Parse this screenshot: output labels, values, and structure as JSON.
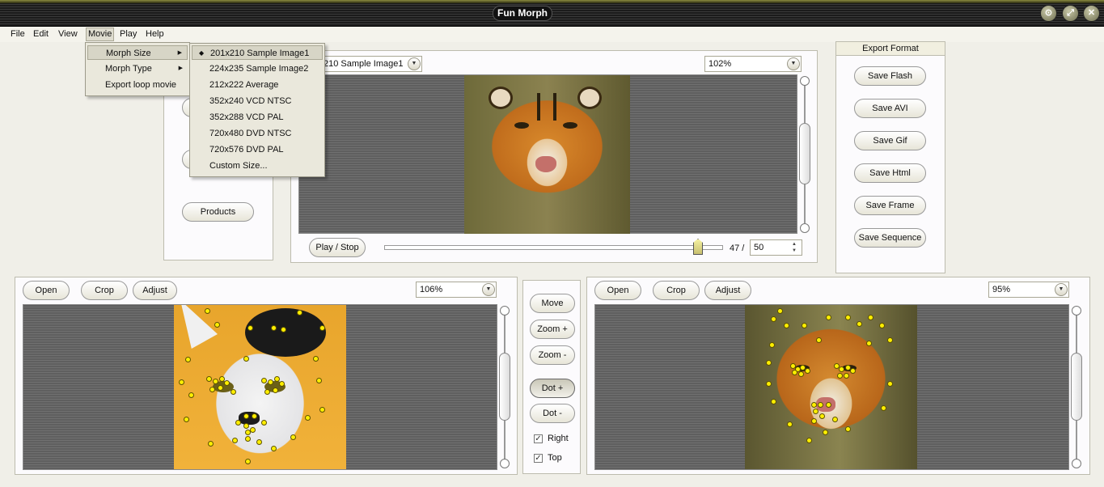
{
  "window": {
    "title": "Fun Morph",
    "minimize_glyph": "⊙",
    "maximize_glyph": "⤢",
    "close_glyph": "✕"
  },
  "menubar": [
    {
      "label": "File"
    },
    {
      "label": "Edit"
    },
    {
      "label": "View"
    },
    {
      "label": "Movie"
    },
    {
      "label": "Play"
    },
    {
      "label": "Help"
    }
  ],
  "movie_menu": {
    "items": [
      {
        "label": "Morph Size"
      },
      {
        "label": "Morph Type"
      },
      {
        "label": "Export loop movie"
      }
    ]
  },
  "morph_size_menu": {
    "items": [
      {
        "label": "201x210 Sample Image1"
      },
      {
        "label": "224x235 Sample Image2"
      },
      {
        "label": "212x222 Average"
      },
      {
        "label": "352x240 VCD NTSC"
      },
      {
        "label": "352x288 VCD PAL"
      },
      {
        "label": "720x480 DVD NTSC"
      },
      {
        "label": "720x576 DVD PAL"
      },
      {
        "label": "Custom Size..."
      }
    ]
  },
  "left_panel": {
    "products_label": "Products"
  },
  "preview": {
    "size_select": "210 Sample Image1",
    "zoom": "102%",
    "play_stop_label": "Play / Stop",
    "frame_current": "47 /",
    "frame_total": "50",
    "frame_position": 0.94
  },
  "export": {
    "title": "Export Format",
    "buttons": [
      "Save Flash",
      "Save AVI",
      "Save Gif",
      "Save Html",
      "Save Frame",
      "Save Sequence"
    ]
  },
  "source_left": {
    "open_label": "Open",
    "crop_label": "Crop",
    "adjust_label": "Adjust",
    "zoom": "106%"
  },
  "source_right": {
    "open_label": "Open",
    "crop_label": "Crop",
    "adjust_label": "Adjust",
    "zoom": "95%"
  },
  "tools": {
    "move_label": "Move",
    "zoom_in_label": "Zoom +",
    "zoom_out_label": "Zoom -",
    "dot_add_label": "Dot +",
    "dot_remove_label": "Dot -",
    "right_label": "Right",
    "top_label": "Top",
    "right_checked": true,
    "top_checked": true,
    "check_glyph": "✓"
  },
  "icons": {
    "dropdown_arrow": "▼",
    "submenu_arrow": "▶",
    "selected_dot": "◆",
    "spinner_up": "▲",
    "spinner_down": "▼"
  }
}
